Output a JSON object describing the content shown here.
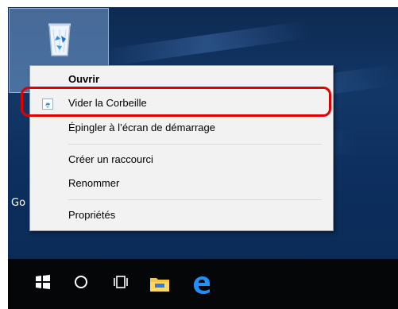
{
  "desktop": {
    "icon": "recycle-bin-icon",
    "partial_label": "Go"
  },
  "context_menu": {
    "items": [
      {
        "label": "Ouvrir",
        "bold": true
      },
      {
        "label": "Vider la Corbeille",
        "icon": "recycle-bin-icon"
      },
      {
        "label": "Épingler à l’écran de démarrage"
      },
      {
        "label": "Créer un raccourci"
      },
      {
        "label": "Renommer"
      },
      {
        "label": "Propriétés"
      }
    ]
  },
  "taskbar": {
    "icons": [
      "windows-start-icon",
      "cortana-search-icon",
      "task-view-icon",
      "file-explorer-icon",
      "edge-browser-icon"
    ]
  },
  "colors": {
    "desktop": "#123767",
    "highlight": "#e00000",
    "menu_background": "#f2f2f2",
    "taskbar": "#050608"
  }
}
